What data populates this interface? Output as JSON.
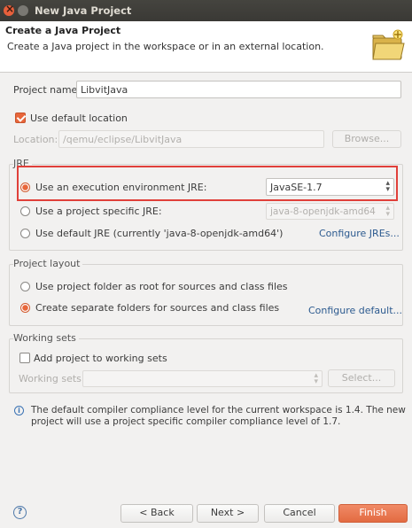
{
  "window": {
    "title": "New Java Project"
  },
  "header": {
    "title": "Create a Java Project",
    "subtitle": "Create a Java project in the workspace or in an external location."
  },
  "project": {
    "name_label": "Project name:",
    "name_value": "LibvitJava",
    "use_default_location_label": "Use default location",
    "use_default_location_checked": true,
    "location_label": "Location:",
    "location_value": "/qemu/eclipse/LibvitJava",
    "browse_label": "Browse..."
  },
  "jre": {
    "group_title": "JRE",
    "option_execution_env": "Use an execution environment JRE:",
    "execution_env_value": "JavaSE-1.7",
    "option_project_specific": "Use a project specific JRE:",
    "project_specific_value": "java-8-openjdk-amd64",
    "option_default": "Use default JRE (currently 'java-8-openjdk-amd64')",
    "configure_link": "Configure JREs...",
    "selected": "execution_env"
  },
  "layout": {
    "group_title": "Project layout",
    "option_root": "Use project folder as root for sources and class files",
    "option_separate": "Create separate folders for sources and class files",
    "configure_link": "Configure default...",
    "selected": "separate"
  },
  "working_sets": {
    "group_title": "Working sets",
    "add_label": "Add project to working sets",
    "add_checked": false,
    "sets_label": "Working sets:",
    "sets_value": "",
    "select_label": "Select..."
  },
  "info": {
    "line1": "The default compiler compliance level for the current workspace is 1.4. The new",
    "line2": "project will use a project specific compiler compliance level of 1.7."
  },
  "footer": {
    "help_icon": "?",
    "back_label": "< Back",
    "next_label": "Next >",
    "cancel_label": "Cancel",
    "finish_label": "Finish"
  },
  "colors": {
    "accent": "#e8663a",
    "highlight_box": "#e0403a",
    "link": "#2c5a8f"
  }
}
